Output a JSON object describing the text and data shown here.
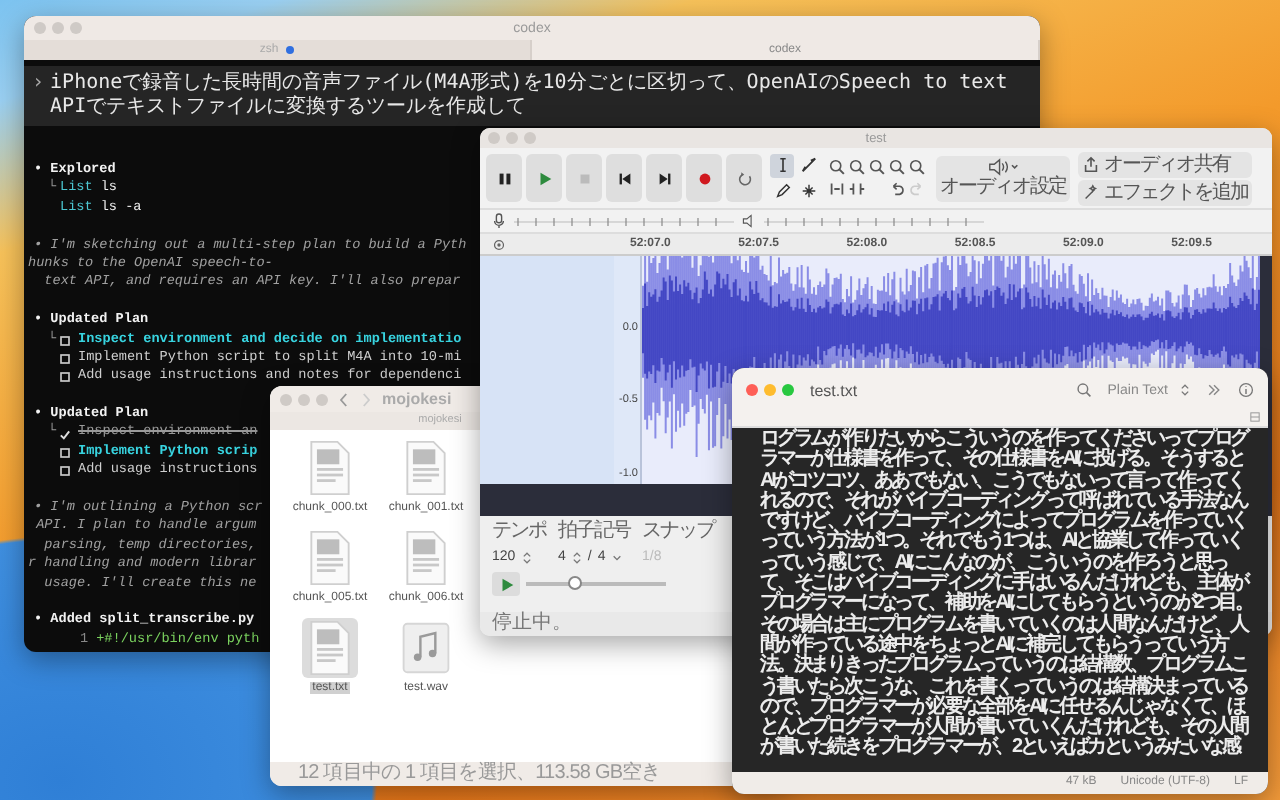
{
  "terminal": {
    "title": "codex",
    "tabs": [
      {
        "label": "zsh",
        "selected": false,
        "activity": true
      },
      {
        "label": "codex",
        "selected": true,
        "activity": false
      }
    ],
    "prompt": {
      "mark": "›",
      "text": "iPhoneで録音した長時間の音声ファイル(M4A形式)を10分ごとに区切って、OpenAIのSpeech to text APIでテキストファイルに変換するツールを作成して"
    },
    "lines": [
      {
        "kind": "heading",
        "text": "• Explored"
      },
      {
        "kind": "command",
        "branch": "└",
        "cmd": "List",
        "arg": "ls"
      },
      {
        "kind": "command",
        "cmd": "List",
        "arg": "ls -a"
      },
      {
        "kind": "note",
        "text": "• I'm sketching out a multi-step plan to build a Pyth"
      },
      {
        "kind": "note_cont",
        "text": "hunks to the OpenAI speech-to-"
      },
      {
        "kind": "note_cont",
        "text": "  text API, and requires an API key. I'll also prepar"
      },
      {
        "kind": "heading",
        "text": "• Updated Plan"
      },
      {
        "kind": "task",
        "branch": "└",
        "checked": false,
        "active": true,
        "text": "Inspect environment and decide on implementatio"
      },
      {
        "kind": "task",
        "checked": false,
        "active": false,
        "text": "Implement Python script to split M4A into 10-mi"
      },
      {
        "kind": "task",
        "checked": false,
        "active": false,
        "text": "Add usage instructions and notes for dependenci"
      },
      {
        "kind": "heading",
        "text": "• Updated Plan"
      },
      {
        "kind": "task",
        "branch": "└",
        "checked": true,
        "active": false,
        "text": "Inspect environment an"
      },
      {
        "kind": "task",
        "checked": false,
        "active": true,
        "text": "Implement Python scrip"
      },
      {
        "kind": "task",
        "checked": false,
        "active": false,
        "text": "Add usage instructions"
      },
      {
        "kind": "note",
        "text": "• I'm outlining a Python scr"
      },
      {
        "kind": "note_cont",
        "text": " API. I plan to handle argum"
      },
      {
        "kind": "note_cont",
        "text": "  parsing, temp directories,"
      },
      {
        "kind": "note_cont",
        "text": "r handling and modern librar"
      },
      {
        "kind": "note_cont",
        "text": "  usage. I'll create this ne"
      },
      {
        "kind": "heading",
        "text": "• Added split_transcribe.py"
      },
      {
        "kind": "diff",
        "num": "1",
        "text": "+#!/usr/bin/env pyth"
      }
    ]
  },
  "finder": {
    "title": "mojokesi",
    "path": "mojokesi",
    "files": [
      {
        "name": "chunk_000.txt",
        "kind": "text",
        "selected": false
      },
      {
        "name": "chunk_001.txt",
        "kind": "text",
        "selected": false
      },
      {
        "name": "chunk_005.txt",
        "kind": "text",
        "selected": false
      },
      {
        "name": "chunk_006.txt",
        "kind": "text",
        "selected": false
      },
      {
        "name": "test.txt",
        "kind": "text",
        "selected": true
      },
      {
        "name": "test.wav",
        "kind": "audio",
        "selected": false
      }
    ],
    "status": "12 項目中の 1 項目を選択、113.58 GB空き"
  },
  "audio_editor": {
    "title": "test",
    "tools": [
      {
        "kind": "select",
        "selected": true
      },
      {
        "kind": "envelope",
        "selected": false
      },
      {
        "kind": "draw",
        "selected": false
      },
      {
        "kind": "multi",
        "selected": false
      }
    ],
    "audio_setup": "オーディオ設定",
    "share": "オーディオ共有",
    "effects": "エフェクトを追加",
    "timeline": [
      "52:07.0",
      "52:07.5",
      "52:08.0",
      "52:08.5",
      "52:09.0",
      "52:09.5"
    ],
    "axis": [
      "0.0",
      "-0.5",
      "-1.0"
    ],
    "tempo_label": "テンポ",
    "tempo": "120",
    "meter_label": "拍子記号",
    "beats": "4",
    "slash": "/",
    "unit": "4",
    "snap_label": "スナップ",
    "snap": "1/8",
    "snap_disabled": true,
    "speed": {
      "level": 0.35
    },
    "status": "停止中。"
  },
  "editor": {
    "title": "test.txt",
    "syntax": "Plain Text",
    "body": "ログラムが作りたいからこういうのを作ってくださいってプログラマーが仕様書を作って、その仕様書をAIに投げる。そうするとAIがコツコツ、ああでもない、こうでもないって言って作ってくれるので、それがバイブコーディングって呼ばれている手法なんですけど、バイブコーディングによってプログラムを作っていくっていう方法が1つ。それでもう1つは、AIと協業して作っていくっていう感じで、AIにこんなのが、こういうのを作ろうと思って、そこはバイブコーディングに手はいるんだけれども、主体がプログラマーになって、補助をAIにしてもらうというのが2つ目。その場合は主にプログラムを書いていくのは人間なんだけど、人間が作っている途中をちょっとAIに補完してもらうっていう方法。決まりきったプログラムっていうのは結構数、プログラムこう書いたら次こうな、これを書くっていうのは結構決まっているので、プログラマーが必要な全部をAIに任せるんじゃなくて、ほとんどプログラマーが人間が書いていくんだけれども、その人間が書いた続きをプログラマーが、2といえばカというみたいな感",
    "size": "47 kB",
    "encoding": "Unicode (UTF-8)",
    "line_ending": "LF"
  }
}
